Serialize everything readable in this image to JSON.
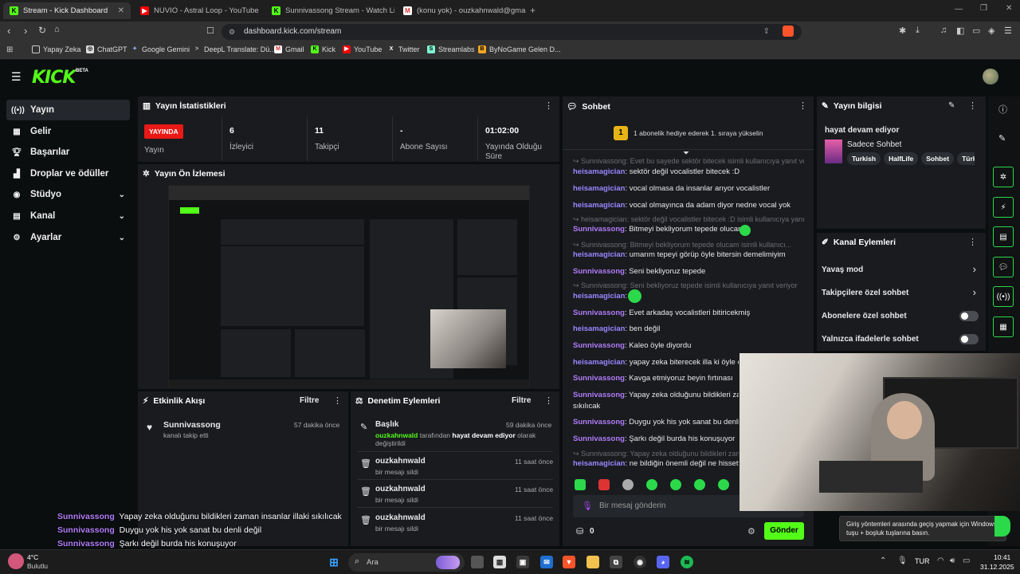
{
  "browser": {
    "tabs": [
      {
        "title": "Stream - Kick Dashboard",
        "active": true,
        "icon": "kick-icon"
      },
      {
        "title": "NUVIO - Astral Loop - YouTube",
        "active": false,
        "icon": "youtube-icon"
      },
      {
        "title": "Sunnivassong Stream - Watch Live o",
        "active": false,
        "icon": "kick-icon"
      },
      {
        "title": "(konu yok) - ouzkahnwald@gmail.co",
        "active": false,
        "icon": "gmail-icon"
      }
    ],
    "url": "dashboard.kick.com/stream",
    "bookmarks": [
      "Yapay Zeka",
      "ChatGPT",
      "Google Gemini",
      "DeepL Translate: Dü...",
      "Gmail",
      "Kick",
      "YouTube",
      "Twitter",
      "Streamlabs",
      "ByNoGame Gelen D..."
    ]
  },
  "kick": {
    "logo": "KICK",
    "beta": "BETA"
  },
  "sidebar": {
    "items": [
      {
        "label": "Yayın",
        "icon": "broadcast-icon",
        "active": true
      },
      {
        "label": "Gelir",
        "icon": "revenue-icon"
      },
      {
        "label": "Başarılar",
        "icon": "trophy-icon"
      },
      {
        "label": "Droplar ve ödüller",
        "icon": "drops-icon"
      },
      {
        "label": "Stüdyo",
        "icon": "studio-icon",
        "expandable": true
      },
      {
        "label": "Kanal",
        "icon": "channel-icon",
        "expandable": true
      },
      {
        "label": "Ayarlar",
        "icon": "gear-icon",
        "expandable": true
      }
    ]
  },
  "stats": {
    "title": "Yayın İstatistikleri",
    "live_badge": "YAYINDA",
    "live_label": "Yayın",
    "viewers_value": "6",
    "viewers_label": "İzleyici",
    "followers_value": "11",
    "followers_label": "Takipçi",
    "subs_value": "-",
    "subs_label": "Abone Sayısı",
    "duration_value": "01:02:00",
    "duration_label": "Yayında Olduğu Süre"
  },
  "preview": {
    "title": "Yayın Ön İzlemesi"
  },
  "activity": {
    "title": "Etkinlik Akışı",
    "filter": "Filtre",
    "items": [
      {
        "user": "Sunnivassong",
        "action": "kanalı takip etti",
        "time": "57 dakika önce"
      }
    ]
  },
  "moderation": {
    "title": "Denetim Eylemleri",
    "filter": "Filtre",
    "first": {
      "title": "Başlık",
      "time": "59 dakika önce",
      "user": "ouzkahnwald",
      "mid": "tarafından",
      "value": "hayat devam ediyor",
      "tail": "olarak",
      "tail2": "değiştirildi"
    },
    "items": [
      {
        "user": "ouzkahnwald",
        "action": "bir mesajı sildi",
        "time": "11 saat önce"
      },
      {
        "user": "ouzkahnwald",
        "action": "bir mesajı sildi",
        "time": "11 saat önce"
      },
      {
        "user": "ouzkahnwald",
        "action": "bir mesajı sildi",
        "time": "11 saat önce"
      }
    ]
  },
  "chat": {
    "title": "Sohbet",
    "gift_num": "1",
    "gift_text": "1 abonelik hediye ederek 1. sıraya yükselin",
    "messages": [
      {
        "type": "reply",
        "text": "Sunnivassong: Evet bu sayede sektör bitecek isimli kullanıcıya yanıt ve..."
      },
      {
        "user": "heisamagician",
        "text": "sektör değil vocalistler bitecek :D"
      },
      {
        "user": "heisamagician",
        "text": "vocal olmasa da insanlar arıyor vocalistler"
      },
      {
        "user": "heisamagician",
        "text": "vocal olmayınca da adam diyor nedne vocal yok"
      },
      {
        "type": "reply",
        "text": "heisamagician: sektör değil vocalistler bitecek :D isimli kullanıcıya yanı..."
      },
      {
        "user": "Sunnivassong",
        "text": "Bitmeyi bekliyorum tepede olucam"
      },
      {
        "type": "reply",
        "text": "Sunnivassong: Bitmeyi bekliyorum tepede olucam        isimli kullanıcı..."
      },
      {
        "user": "heisamagician",
        "text": "umarım tepeyi görüp öyle bitersin demelimiyim"
      },
      {
        "user": "Sunnivassong",
        "text": "Seni bekliyoruz tepede"
      },
      {
        "type": "reply",
        "text": "Sunnivassong: Seni bekliyoruz tepede isimli kullanıcıya yanıt veriyor"
      },
      {
        "user": "heisamagician",
        "text": ""
      },
      {
        "user": "Sunnivassong",
        "text": "Evet arkadaş vocalistleri bitiricekmiş"
      },
      {
        "user": "heisamagician",
        "text": "ben değil"
      },
      {
        "user": "Sunnivassong",
        "text": "Kaleo öyle diyordu"
      },
      {
        "user": "heisamagician",
        "text": "yapay zeka biterecek illa ki öyle ola"
      },
      {
        "user": "Sunnivassong",
        "text": "Kavga etmiyoruz beyin fırtınası"
      },
      {
        "user": "Sunnivassong",
        "text": "Yapay zeka olduğunu bildikleri zam"
      },
      {
        "user": "",
        "text": "sıkılıcak"
      },
      {
        "user": "Sunnivassong",
        "text": "Duygu yok his yok sanat bu denli d"
      },
      {
        "user": "Sunnivassong",
        "text": "Şarkı değil burda his konuşuyor"
      },
      {
        "type": "reply",
        "text": "Sunnivassong: Yapay zeka olduğunu bildikleri zaman"
      },
      {
        "user": "heisamagician",
        "text": "ne bildiğin önemli değil ne hissettir"
      }
    ],
    "input_placeholder": "Bir mesaj gönderin",
    "points": "0",
    "send": "Gönder"
  },
  "stream_info": {
    "title": "Yayın bilgisi",
    "stream_title": "hayat devam ediyor",
    "category": "Sadece Sohbet",
    "tags": [
      "Turkish",
      "HalfLife",
      "Sohbet",
      "Türkç"
    ]
  },
  "channel_actions": {
    "title": "Kanal Eylemleri",
    "slow_mode": "Yavaş mod",
    "followers_only": "Takipçilere özel sohbet",
    "subs_only": "Abonelere özel sohbet",
    "emotes_only": "Yalnızca ifadelerle sohbet"
  },
  "overlay": {
    "lines": [
      {
        "user": "Sunnivassong",
        "text": "Yapay zeka olduğunu bildikleri zaman insanlar illaki sıkılıcak"
      },
      {
        "user": "Sunnivassong",
        "text": "Duygu yok his yok sanat bu denli değil"
      },
      {
        "user": "Sunnivassong",
        "text": "Şarkı değil burda his konuşuyor"
      }
    ]
  },
  "toast": {
    "text": "Giriş yöntemleri arasında geçiş yapmak için Windows tuşu + boşluk tuşlarına basın."
  },
  "taskbar": {
    "weather_temp": "4°C",
    "weather_desc": "Bulutlu",
    "search": "Ara",
    "lang": "TUR",
    "time": "10:41",
    "date": "31.12.2025"
  },
  "colors": {
    "accent": "#53fc18",
    "live": "#e91916",
    "username": "#b07cf7"
  }
}
